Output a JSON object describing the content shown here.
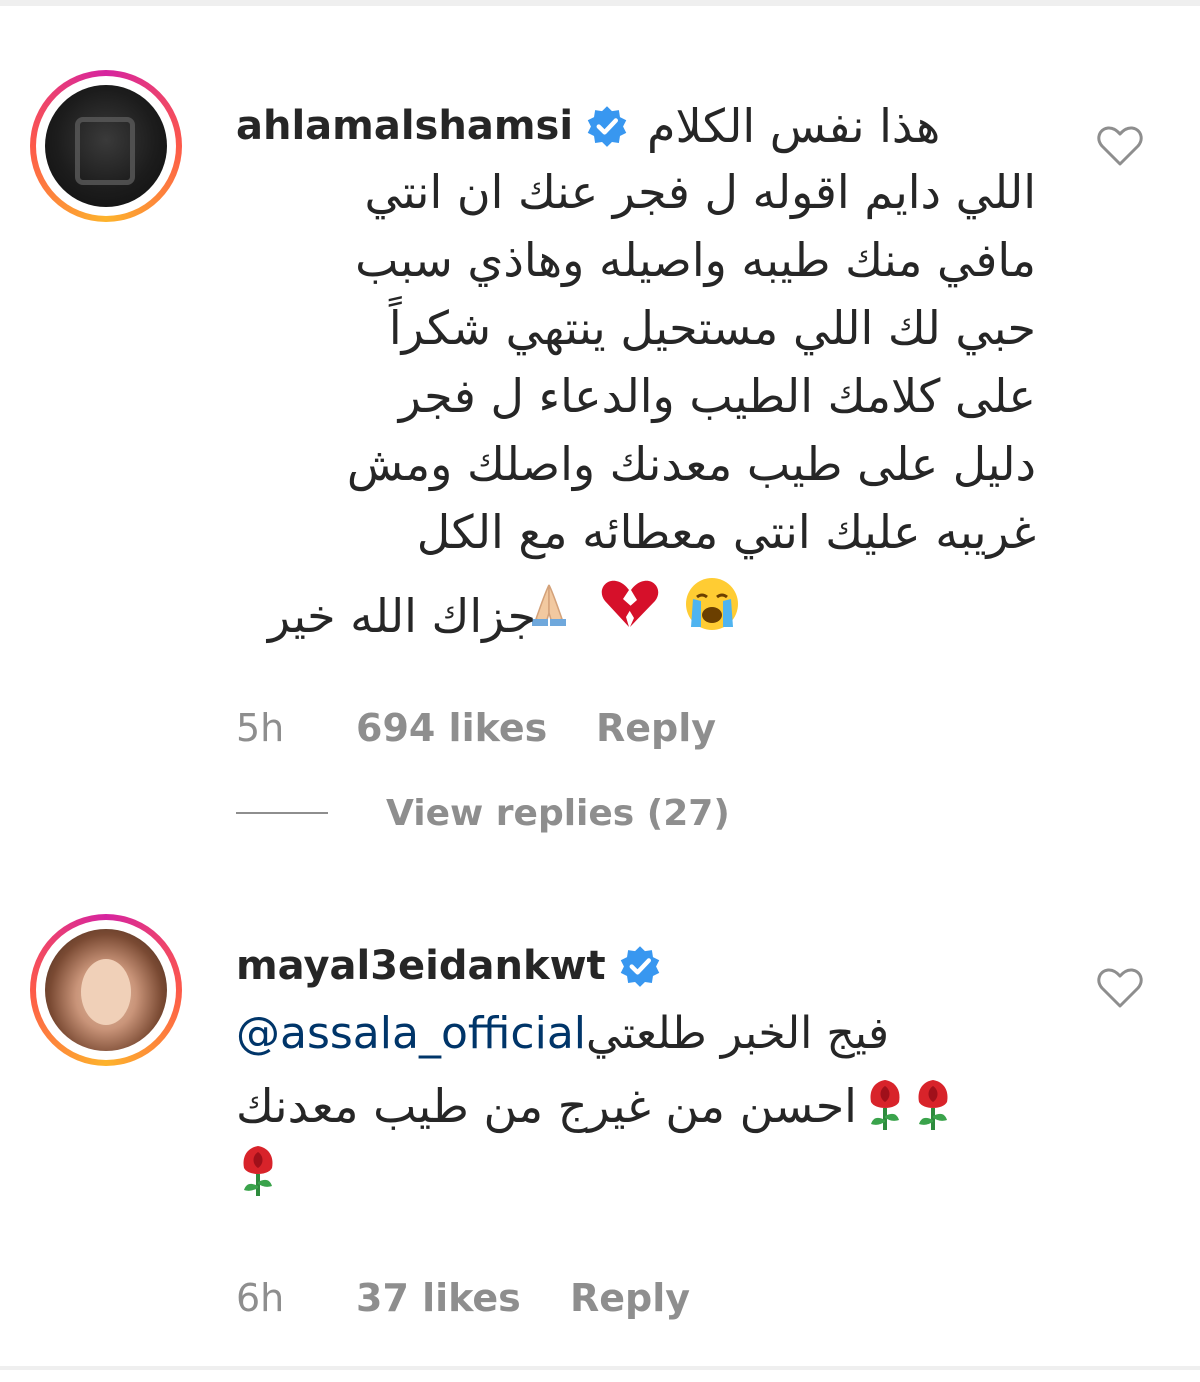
{
  "comments": [
    {
      "username": "ahlamalshamsi",
      "verified": true,
      "first_line": "هذا نفس الكلام",
      "lines": [
        "اللي دايم اقوله ل فجر عنك ان انتي",
        "مافي منك طيبه واصيله وهاذي سبب",
        "حبي لك اللي مستحيل ينتهي شكراً",
        "على كلامك الطيب والدعاء ل فجر",
        "دليل على طيب معدنك واصلك ومش",
        "غريبه عليك انتي معطائه مع الكل",
        "جزاك الله خير"
      ],
      "emojis": [
        "folded-hands-emoji",
        "broken-heart-emoji",
        "crying-face-emoji"
      ],
      "time": "5h",
      "likes": "694 likes",
      "reply_label": "Reply",
      "view_replies": "View replies (27)",
      "avatar": "dark-logo-avatar"
    },
    {
      "username": "mayal3eidankwt",
      "verified": true,
      "mention": "@assala_official",
      "mention_suffix": "فيج الخبر طلعتي",
      "lines": [
        "احسن من غيرج من طيب معدنك"
      ],
      "emojis": [
        "rose-emoji",
        "rose-emoji",
        "rose-emoji"
      ],
      "time": "6h",
      "likes": "37 likes",
      "reply_label": "Reply",
      "avatar": "portrait-avatar"
    }
  ],
  "colors": {
    "text": "#262626",
    "meta": "#8e8e8e",
    "verified": "#3897f0",
    "mention": "#003569",
    "ring_start": "#d6249f",
    "ring_end": "#fdb32c"
  }
}
